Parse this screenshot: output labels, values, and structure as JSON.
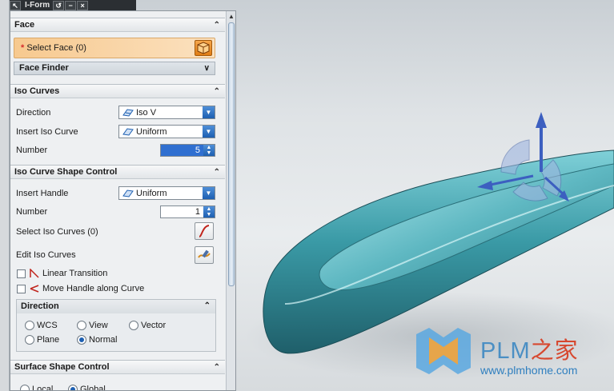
{
  "titlebar": {
    "title": "I-Form",
    "buttons": [
      "↖",
      "↺",
      "−",
      "×"
    ]
  },
  "face": {
    "header": "Face",
    "select_face_label": "Select Face (0)",
    "face_finder_label": "Face Finder"
  },
  "iso_curves": {
    "header": "Iso Curves",
    "direction_label": "Direction",
    "direction_value": "Iso V",
    "insert_label": "Insert Iso Curve",
    "insert_value": "Uniform",
    "number_label": "Number",
    "number_value": "5"
  },
  "shape_control": {
    "header": "Iso Curve Shape Control",
    "insert_handle_label": "Insert Handle",
    "insert_handle_value": "Uniform",
    "number_label": "Number",
    "number_value": "1",
    "select_iso_label": "Select Iso Curves (0)",
    "edit_iso_label": "Edit Iso Curves",
    "linear_transition_label": "Linear Transition",
    "move_handle_label": "Move Handle along Curve"
  },
  "direction": {
    "header": "Direction",
    "options": [
      "WCS",
      "View",
      "Vector",
      "Plane",
      "Normal"
    ],
    "selected": "Normal"
  },
  "surface_shape": {
    "header": "Surface Shape Control",
    "options": [
      "Local",
      "Global"
    ],
    "selected": "Global"
  },
  "watermark": {
    "brand": "PLM",
    "cn": "之家",
    "url": "www.plmhome.com"
  },
  "colors": {
    "accent": "#1d5fb1",
    "select_face_bg": "#f7c98f",
    "model": "#3a9aa6"
  }
}
